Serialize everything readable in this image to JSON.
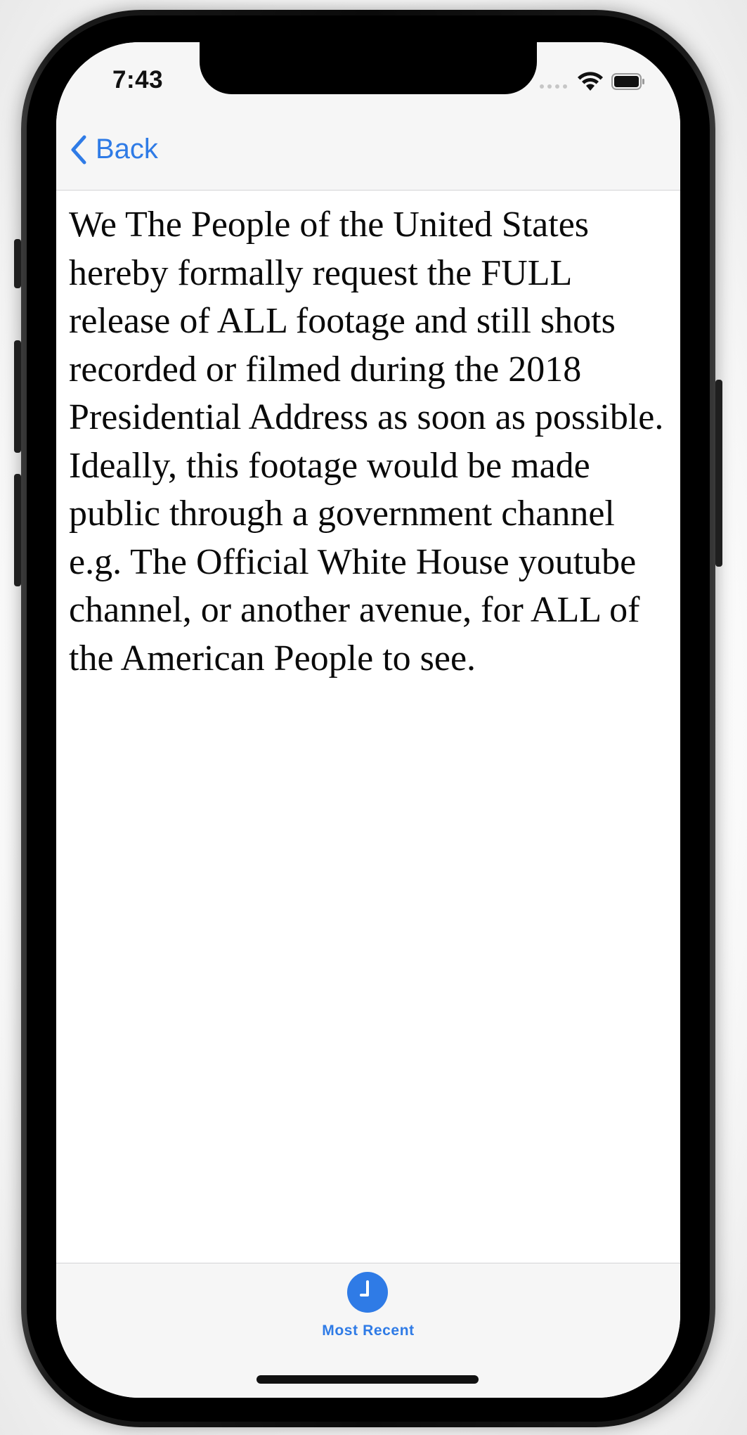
{
  "status_bar": {
    "time": "7:43"
  },
  "nav": {
    "back_label": "Back"
  },
  "content": {
    "text": "We The People of the United States hereby formally request the FULL release of ALL footage and still shots recorded or filmed during the 2018 Presidential Address as soon as possible. Ideally, this footage would be made public through a government channel e.g. The Official White House youtube channel, or another avenue, for ALL of the American People to see."
  },
  "tabbar": {
    "items": [
      {
        "label": "Most Recent",
        "icon": "clock-icon"
      }
    ]
  },
  "colors": {
    "accent": "#2f7be6",
    "bar_background": "#f6f6f6",
    "text": "#0a0a0a"
  }
}
